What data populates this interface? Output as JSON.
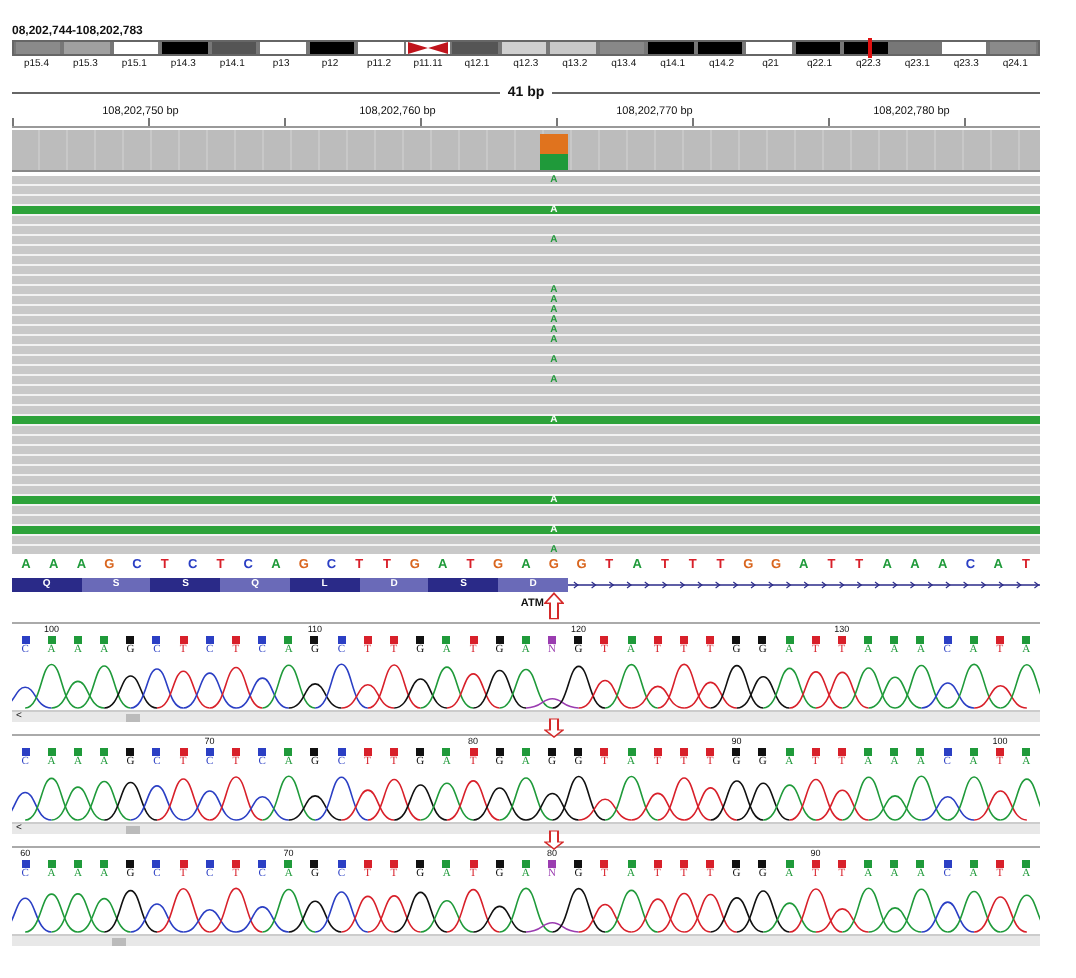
{
  "locus": "08,202,744-108,202,783",
  "ideogram": [
    {
      "label": "p15.4",
      "color": "#8a8a8a"
    },
    {
      "label": "p15.3",
      "color": "#a0a0a0"
    },
    {
      "label": "p15.1",
      "color": "#ffffff"
    },
    {
      "label": "p14.3",
      "color": "#000000"
    },
    {
      "label": "p14.1",
      "color": "#555555"
    },
    {
      "label": "p13",
      "color": "#ffffff"
    },
    {
      "label": "p12",
      "color": "#000000"
    },
    {
      "label": "p11.2",
      "color": "#ffffff"
    },
    {
      "label": "p11.11",
      "color": "#c0141c",
      "kind": "centromere"
    },
    {
      "label": "q12.1",
      "color": "#555555"
    },
    {
      "label": "q12.3",
      "color": "#d0d0d0"
    },
    {
      "label": "q13.2",
      "color": "#c8c8c8"
    },
    {
      "label": "q13.4",
      "color": "#888888"
    },
    {
      "label": "q14.1",
      "color": "#000000"
    },
    {
      "label": "q14.2",
      "color": "#000000"
    },
    {
      "label": "q21",
      "color": "#ffffff"
    },
    {
      "label": "q22.1",
      "color": "#000000"
    },
    {
      "label": "q22.3",
      "color": "#000000",
      "current": true
    },
    {
      "label": "q23.1",
      "color": "#777777"
    },
    {
      "label": "q23.3",
      "color": "#ffffff"
    },
    {
      "label": "q24.1",
      "color": "#8a8a8a"
    }
  ],
  "span": "41 bp",
  "positions": [
    "108,202,750 bp",
    "108,202,760 bp",
    "108,202,770 bp",
    "108,202,780 bp"
  ],
  "coverage": {
    "level": 0.45
  },
  "reads": [
    {
      "highlight": false,
      "base": "A"
    },
    {
      "highlight": false
    },
    {
      "highlight": false
    },
    {
      "highlight": true,
      "base": "A"
    },
    {
      "highlight": false
    },
    {
      "highlight": false
    },
    {
      "highlight": false,
      "base": "A"
    },
    {
      "highlight": false
    },
    {
      "highlight": false
    },
    {
      "highlight": false
    },
    {
      "highlight": false
    },
    {
      "highlight": false,
      "base": "A"
    },
    {
      "highlight": false,
      "base": "A"
    },
    {
      "highlight": false,
      "base": "A"
    },
    {
      "highlight": false,
      "base": "A"
    },
    {
      "highlight": false,
      "base": "A"
    },
    {
      "highlight": false,
      "base": "A"
    },
    {
      "highlight": false
    },
    {
      "highlight": false,
      "base": "A"
    },
    {
      "highlight": false
    },
    {
      "highlight": false,
      "base": "A"
    },
    {
      "highlight": false
    },
    {
      "highlight": false
    },
    {
      "highlight": false
    },
    {
      "highlight": true,
      "base": "A"
    },
    {
      "highlight": false
    },
    {
      "highlight": false
    },
    {
      "highlight": false
    },
    {
      "highlight": false
    },
    {
      "highlight": false
    },
    {
      "highlight": false
    },
    {
      "highlight": false
    },
    {
      "highlight": true,
      "base": "A"
    },
    {
      "highlight": false
    },
    {
      "highlight": false
    },
    {
      "highlight": true,
      "base": "A"
    },
    {
      "highlight": false
    },
    {
      "highlight": false,
      "base": "A"
    }
  ],
  "reference": [
    {
      "base": "A",
      "color": "#1f9a3a",
      "variant": false
    },
    {
      "base": "A",
      "color": "#1f9a3a",
      "variant": false
    },
    {
      "base": "A",
      "color": "#1f9a3a",
      "variant": false
    },
    {
      "base": "G",
      "color": "#d9661f",
      "variant": false
    },
    {
      "base": "C",
      "color": "#2b3fc4",
      "variant": false
    },
    {
      "base": "T",
      "color": "#d8202a",
      "variant": false
    },
    {
      "base": "C",
      "color": "#2b3fc4",
      "variant": false
    },
    {
      "base": "T",
      "color": "#d8202a",
      "variant": false
    },
    {
      "base": "C",
      "color": "#2b3fc4",
      "variant": false
    },
    {
      "base": "A",
      "color": "#1f9a3a",
      "variant": false
    },
    {
      "base": "G",
      "color": "#d9661f",
      "variant": false
    },
    {
      "base": "C",
      "color": "#2b3fc4",
      "variant": false
    },
    {
      "base": "T",
      "color": "#d8202a",
      "variant": false
    },
    {
      "base": "T",
      "color": "#d8202a",
      "variant": false
    },
    {
      "base": "G",
      "color": "#d9661f",
      "variant": false
    },
    {
      "base": "A",
      "color": "#1f9a3a",
      "variant": false
    },
    {
      "base": "T",
      "color": "#d8202a",
      "variant": false
    },
    {
      "base": "G",
      "color": "#d9661f",
      "variant": false
    },
    {
      "base": "A",
      "color": "#1f9a3a",
      "variant": false
    },
    {
      "base": "G",
      "color": "#d9661f",
      "variant": true
    },
    {
      "base": "G",
      "color": "#d9661f",
      "variant": false
    },
    {
      "base": "T",
      "color": "#d8202a",
      "variant": false
    },
    {
      "base": "A",
      "color": "#1f9a3a",
      "variant": false
    },
    {
      "base": "T",
      "color": "#d8202a",
      "variant": false
    },
    {
      "base": "T",
      "color": "#d8202a",
      "variant": false
    },
    {
      "base": "T",
      "color": "#d8202a",
      "variant": false
    },
    {
      "base": "G",
      "color": "#d9661f",
      "variant": false
    },
    {
      "base": "G",
      "color": "#d9661f",
      "variant": false
    },
    {
      "base": "A",
      "color": "#1f9a3a",
      "variant": false
    },
    {
      "base": "T",
      "color": "#d8202a",
      "variant": false
    },
    {
      "base": "T",
      "color": "#d8202a",
      "variant": false
    },
    {
      "base": "A",
      "color": "#1f9a3a",
      "variant": false
    },
    {
      "base": "A",
      "color": "#1f9a3a",
      "variant": false
    },
    {
      "base": "A",
      "color": "#1f9a3a",
      "variant": false
    },
    {
      "base": "C",
      "color": "#2b3fc4",
      "variant": false
    },
    {
      "base": "A",
      "color": "#1f9a3a",
      "variant": false
    },
    {
      "base": "T",
      "color": "#d8202a",
      "variant": false
    }
  ],
  "gene": {
    "name": "ATM",
    "amino_acids": [
      "Q",
      "S",
      "S",
      "Q",
      "L",
      "D",
      "S",
      "D"
    ]
  },
  "chromatograms": [
    {
      "scroll_arrow": "<",
      "bases": [
        {
          "base": "C",
          "color": "#2b3fc4"
        },
        {
          "base": "A",
          "color": "#1f9a3a",
          "tick": "100"
        },
        {
          "base": "A",
          "color": "#1f9a3a"
        },
        {
          "base": "A",
          "color": "#1f9a3a"
        },
        {
          "base": "G",
          "color": "#111111"
        },
        {
          "base": "C",
          "color": "#2b3fc4"
        },
        {
          "base": "T",
          "color": "#d8202a"
        },
        {
          "base": "C",
          "color": "#2b3fc4"
        },
        {
          "base": "T",
          "color": "#d8202a"
        },
        {
          "base": "C",
          "color": "#2b3fc4"
        },
        {
          "base": "A",
          "color": "#1f9a3a"
        },
        {
          "base": "G",
          "color": "#111111",
          "tick": "110"
        },
        {
          "base": "C",
          "color": "#2b3fc4"
        },
        {
          "base": "T",
          "color": "#d8202a"
        },
        {
          "base": "T",
          "color": "#d8202a"
        },
        {
          "base": "G",
          "color": "#111111"
        },
        {
          "base": "A",
          "color": "#1f9a3a"
        },
        {
          "base": "T",
          "color": "#d8202a"
        },
        {
          "base": "G",
          "color": "#111111"
        },
        {
          "base": "A",
          "color": "#1f9a3a"
        },
        {
          "base": "N",
          "color": "#9a3cb0"
        },
        {
          "base": "G",
          "color": "#111111",
          "tick": "120"
        },
        {
          "base": "T",
          "color": "#d8202a"
        },
        {
          "base": "A",
          "color": "#1f9a3a"
        },
        {
          "base": "T",
          "color": "#d8202a"
        },
        {
          "base": "T",
          "color": "#d8202a"
        },
        {
          "base": "T",
          "color": "#d8202a"
        },
        {
          "base": "G",
          "color": "#111111"
        },
        {
          "base": "G",
          "color": "#111111"
        },
        {
          "base": "A",
          "color": "#1f9a3a"
        },
        {
          "base": "T",
          "color": "#d8202a"
        },
        {
          "base": "T",
          "color": "#d8202a",
          "tick": "130"
        },
        {
          "base": "A",
          "color": "#1f9a3a"
        },
        {
          "base": "A",
          "color": "#1f9a3a"
        },
        {
          "base": "A",
          "color": "#1f9a3a"
        },
        {
          "base": "C",
          "color": "#2b3fc4"
        },
        {
          "base": "A",
          "color": "#1f9a3a"
        },
        {
          "base": "T",
          "color": "#d8202a"
        },
        {
          "base": "A",
          "color": "#1f9a3a"
        }
      ]
    },
    {
      "scroll_arrow": "<",
      "bases": [
        {
          "base": "C",
          "color": "#2b3fc4"
        },
        {
          "base": "A",
          "color": "#1f9a3a"
        },
        {
          "base": "A",
          "color": "#1f9a3a"
        },
        {
          "base": "A",
          "color": "#1f9a3a"
        },
        {
          "base": "G",
          "color": "#111111"
        },
        {
          "base": "C",
          "color": "#2b3fc4"
        },
        {
          "base": "T",
          "color": "#d8202a"
        },
        {
          "base": "C",
          "color": "#2b3fc4",
          "tick": "70"
        },
        {
          "base": "T",
          "color": "#d8202a"
        },
        {
          "base": "C",
          "color": "#2b3fc4"
        },
        {
          "base": "A",
          "color": "#1f9a3a"
        },
        {
          "base": "G",
          "color": "#111111"
        },
        {
          "base": "C",
          "color": "#2b3fc4"
        },
        {
          "base": "T",
          "color": "#d8202a"
        },
        {
          "base": "T",
          "color": "#d8202a"
        },
        {
          "base": "G",
          "color": "#111111"
        },
        {
          "base": "A",
          "color": "#1f9a3a"
        },
        {
          "base": "T",
          "color": "#d8202a",
          "tick": "80"
        },
        {
          "base": "G",
          "color": "#111111"
        },
        {
          "base": "A",
          "color": "#1f9a3a"
        },
        {
          "base": "G",
          "color": "#111111"
        },
        {
          "base": "G",
          "color": "#111111"
        },
        {
          "base": "T",
          "color": "#d8202a"
        },
        {
          "base": "A",
          "color": "#1f9a3a"
        },
        {
          "base": "T",
          "color": "#d8202a"
        },
        {
          "base": "T",
          "color": "#d8202a"
        },
        {
          "base": "T",
          "color": "#d8202a"
        },
        {
          "base": "G",
          "color": "#111111",
          "tick": "90"
        },
        {
          "base": "G",
          "color": "#111111"
        },
        {
          "base": "A",
          "color": "#1f9a3a"
        },
        {
          "base": "T",
          "color": "#d8202a"
        },
        {
          "base": "T",
          "color": "#d8202a"
        },
        {
          "base": "A",
          "color": "#1f9a3a"
        },
        {
          "base": "A",
          "color": "#1f9a3a"
        },
        {
          "base": "A",
          "color": "#1f9a3a"
        },
        {
          "base": "C",
          "color": "#2b3fc4"
        },
        {
          "base": "A",
          "color": "#1f9a3a"
        },
        {
          "base": "T",
          "color": "#d8202a",
          "tick": "100"
        },
        {
          "base": "A",
          "color": "#1f9a3a"
        }
      ]
    },
    {
      "bases": [
        {
          "base": "C",
          "color": "#2b3fc4",
          "tick": "60"
        },
        {
          "base": "A",
          "color": "#1f9a3a"
        },
        {
          "base": "A",
          "color": "#1f9a3a"
        },
        {
          "base": "A",
          "color": "#1f9a3a"
        },
        {
          "base": "G",
          "color": "#111111"
        },
        {
          "base": "C",
          "color": "#2b3fc4"
        },
        {
          "base": "T",
          "color": "#d8202a"
        },
        {
          "base": "C",
          "color": "#2b3fc4"
        },
        {
          "base": "T",
          "color": "#d8202a"
        },
        {
          "base": "C",
          "color": "#2b3fc4"
        },
        {
          "base": "A",
          "color": "#1f9a3a",
          "tick": "70"
        },
        {
          "base": "G",
          "color": "#111111"
        },
        {
          "base": "C",
          "color": "#2b3fc4"
        },
        {
          "base": "T",
          "color": "#d8202a"
        },
        {
          "base": "T",
          "color": "#d8202a"
        },
        {
          "base": "G",
          "color": "#111111"
        },
        {
          "base": "A",
          "color": "#1f9a3a"
        },
        {
          "base": "T",
          "color": "#d8202a"
        },
        {
          "base": "G",
          "color": "#111111"
        },
        {
          "base": "A",
          "color": "#1f9a3a"
        },
        {
          "base": "N",
          "color": "#9a3cb0",
          "tick": "80"
        },
        {
          "base": "G",
          "color": "#111111"
        },
        {
          "base": "T",
          "color": "#d8202a"
        },
        {
          "base": "A",
          "color": "#1f9a3a"
        },
        {
          "base": "T",
          "color": "#d8202a"
        },
        {
          "base": "T",
          "color": "#d8202a"
        },
        {
          "base": "T",
          "color": "#d8202a"
        },
        {
          "base": "G",
          "color": "#111111"
        },
        {
          "base": "G",
          "color": "#111111"
        },
        {
          "base": "A",
          "color": "#1f9a3a"
        },
        {
          "base": "T",
          "color": "#d8202a",
          "tick": "90"
        },
        {
          "base": "T",
          "color": "#d8202a"
        },
        {
          "base": "A",
          "color": "#1f9a3a"
        },
        {
          "base": "A",
          "color": "#1f9a3a"
        },
        {
          "base": "A",
          "color": "#1f9a3a"
        },
        {
          "base": "C",
          "color": "#2b3fc4"
        },
        {
          "base": "A",
          "color": "#1f9a3a"
        },
        {
          "base": "T",
          "color": "#d8202a"
        },
        {
          "base": "A",
          "color": "#1f9a3a"
        }
      ]
    }
  ]
}
